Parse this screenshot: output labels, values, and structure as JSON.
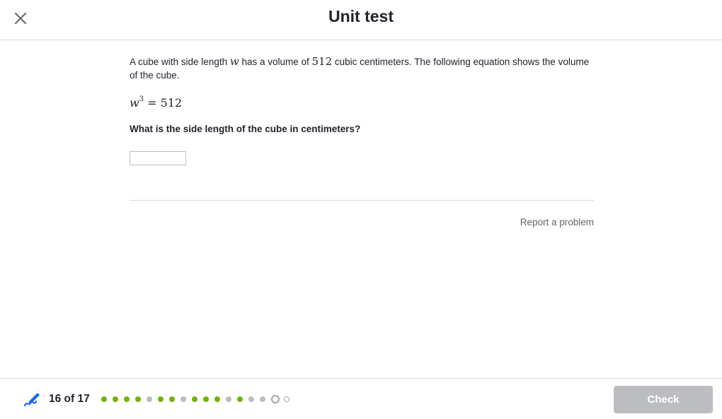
{
  "header": {
    "title": "Unit test",
    "close_icon": "close-icon"
  },
  "problem": {
    "prompt_part1": "A cube with side length ",
    "variable": "w",
    "prompt_part2": " has a volume of ",
    "volume": "512",
    "prompt_part3": " cubic centimeters. The following equation shows the volume of the cube.",
    "equation_base": "w",
    "equation_exponent": "3",
    "equation_rhs": "= 512",
    "question": "What is the side length of the cube in centimeters?",
    "answer_value": "",
    "answer_placeholder": ""
  },
  "report_problem_label": "Report a problem",
  "footer": {
    "icon": "pencil-icon",
    "progress_label": "16 of 17",
    "current_question": 16,
    "total_questions": 17,
    "dot_states": [
      "correct",
      "correct",
      "correct",
      "correct",
      "incorrect",
      "correct",
      "correct",
      "incorrect",
      "correct",
      "correct",
      "correct",
      "incorrect",
      "correct",
      "incorrect",
      "incorrect",
      "current",
      "upcoming"
    ],
    "check_label": "Check"
  },
  "colors": {
    "correct": "#71b307",
    "incorrect": "#babec2",
    "check_disabled": "#bbbdc0",
    "brand_blue": "#1865f2"
  }
}
